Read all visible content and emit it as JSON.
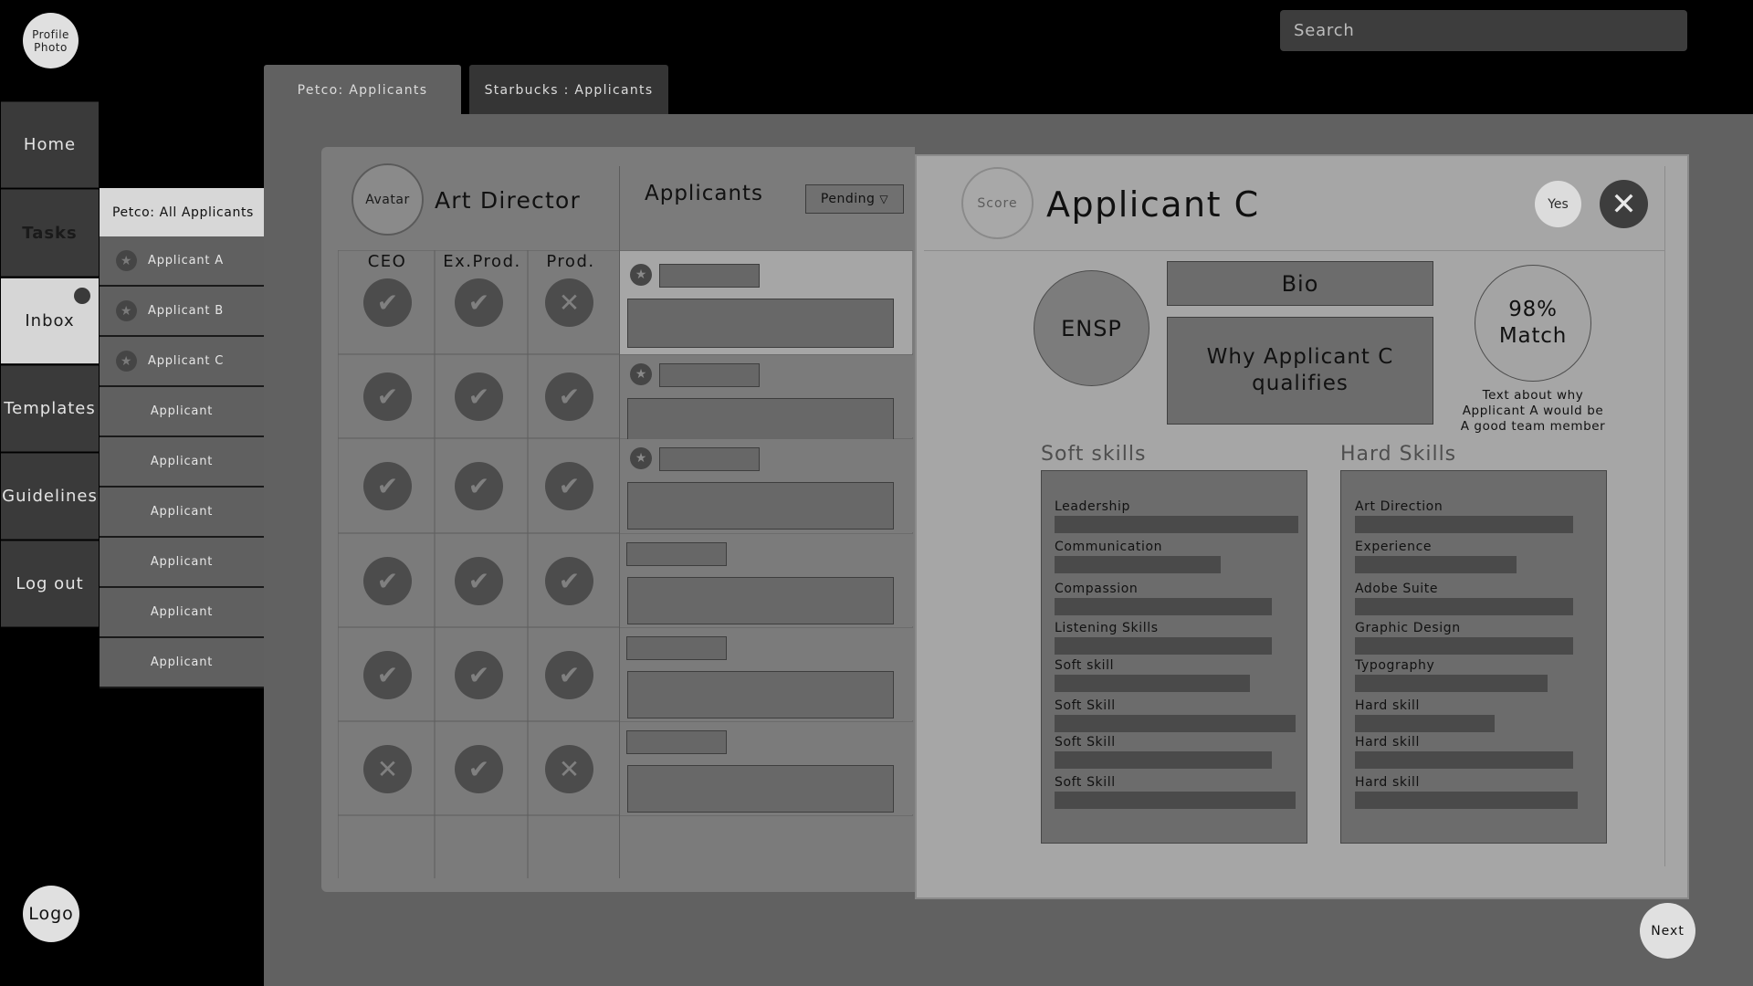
{
  "profile": {
    "label": "Profile\nPhoto"
  },
  "search": {
    "placeholder": "Search"
  },
  "tabs": [
    {
      "label": "Petco: Applicants",
      "active": true
    },
    {
      "label": "Starbucks : Applicants",
      "active": false
    }
  ],
  "nav": {
    "items": [
      "Home",
      "Tasks",
      "Inbox",
      "Templates",
      "Guidelines",
      "Log out"
    ],
    "active": "Inbox",
    "inbox_notification": true
  },
  "logo": {
    "label": "Logo"
  },
  "applicant_list": {
    "header": "Petco: All Applicants",
    "items": [
      {
        "label": "Applicant A",
        "starred": true
      },
      {
        "label": "Applicant B",
        "starred": true
      },
      {
        "label": "Applicant C",
        "starred": true
      },
      {
        "label": "Applicant",
        "starred": false
      },
      {
        "label": "Applicant",
        "starred": false
      },
      {
        "label": "Applicant",
        "starred": false
      },
      {
        "label": "Applicant",
        "starred": false
      },
      {
        "label": "Applicant",
        "starred": false
      },
      {
        "label": "Applicant",
        "starred": false
      }
    ]
  },
  "job": {
    "avatar": "Avatar",
    "title": "Art Director"
  },
  "applicants_panel": {
    "title": "Applicants",
    "filter": "Pending",
    "approval_columns": [
      "CEO",
      "Ex.Prod.",
      "Prod."
    ],
    "rows": [
      {
        "starred": true,
        "approvals": [
          "check",
          "check",
          "x"
        ],
        "selected": true
      },
      {
        "starred": true,
        "approvals": [
          "check",
          "check",
          "check"
        ],
        "selected": false
      },
      {
        "starred": true,
        "approvals": [
          "check",
          "check",
          "check"
        ],
        "selected": false
      },
      {
        "starred": false,
        "approvals": [
          "check",
          "check",
          "check"
        ],
        "selected": false
      },
      {
        "starred": false,
        "approvals": [
          "check",
          "check",
          "check"
        ],
        "selected": false
      },
      {
        "starred": false,
        "approvals": [
          "x",
          "check",
          "x"
        ],
        "selected": false
      }
    ]
  },
  "detail": {
    "score_label": "Score",
    "name": "Applicant C",
    "yes_label": "Yes",
    "personality": "ENSP",
    "bio_label": "Bio",
    "why_label": "Why Applicant C qualifies",
    "match": "98%\nMatch",
    "match_text": "Text about why\nApplicant A would be\nA good team member",
    "soft_skills": {
      "title": "Soft skills",
      "items": [
        {
          "label": "Leadership",
          "level": 1.0
        },
        {
          "label": "Communication",
          "level": 0.68
        },
        {
          "label": "Compassion",
          "level": 0.89
        },
        {
          "label": "Listening Skills",
          "level": 0.89
        },
        {
          "label": "Soft skill",
          "level": 0.8
        },
        {
          "label": "Soft Skill",
          "level": 0.99
        },
        {
          "label": "Soft Skill",
          "level": 0.89
        },
        {
          "label": "Soft Skill",
          "level": 0.99
        }
      ]
    },
    "hard_skills": {
      "title": "Hard Skills",
      "items": [
        {
          "label": "Art Direction",
          "level": 0.92
        },
        {
          "label": "Experience",
          "level": 0.68
        },
        {
          "label": "Adobe Suite",
          "level": 0.92
        },
        {
          "label": "Graphic Design",
          "level": 0.92
        },
        {
          "label": "Typography",
          "level": 0.81
        },
        {
          "label": "Hard skill",
          "level": 0.59
        },
        {
          "label": "Hard skill",
          "level": 0.92
        },
        {
          "label": "Hard skill",
          "level": 0.94
        }
      ]
    }
  },
  "next_label": "Next"
}
